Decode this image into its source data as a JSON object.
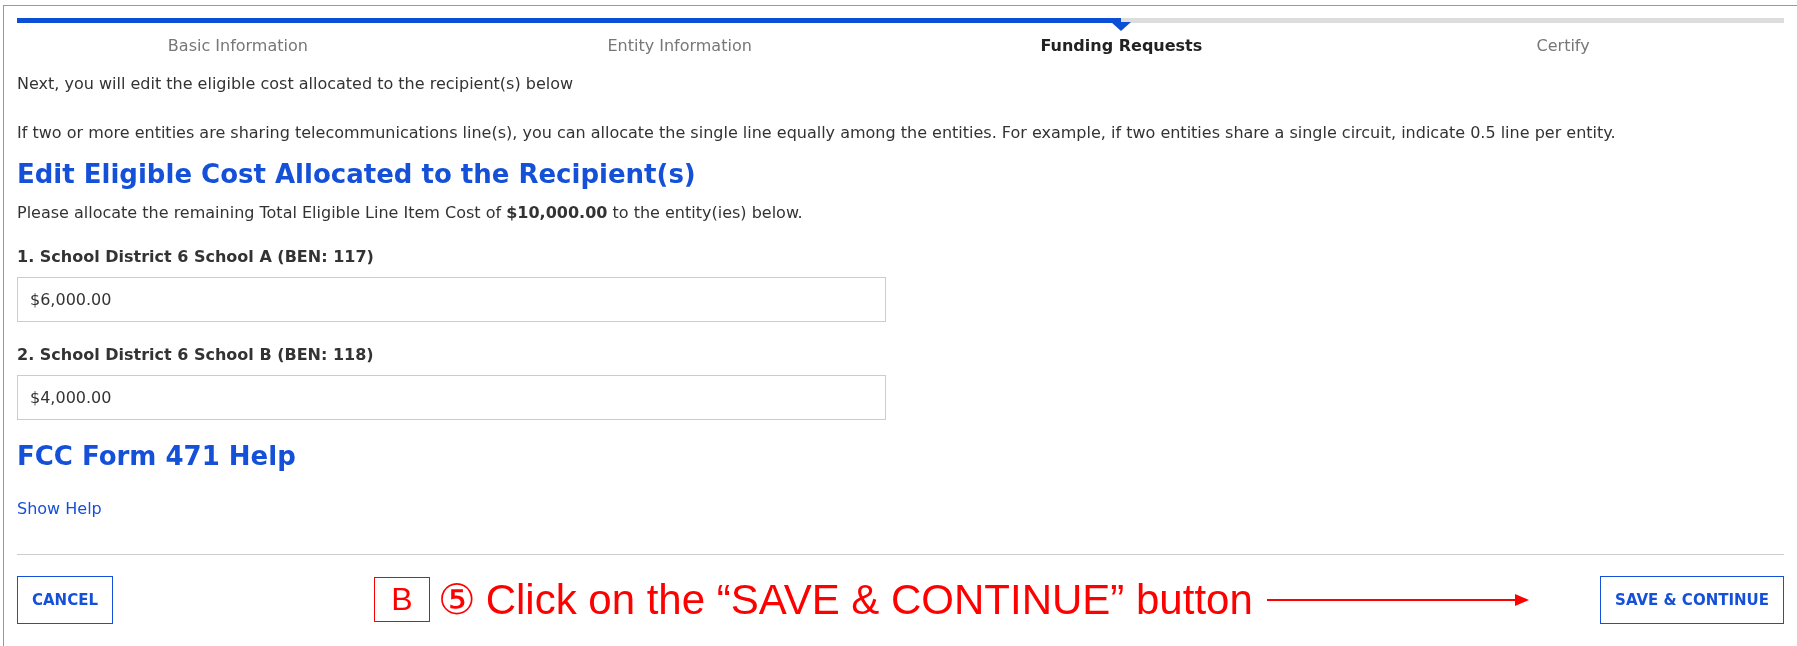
{
  "steps": [
    {
      "label": "Basic Information",
      "selected": false
    },
    {
      "label": "Entity Information",
      "selected": false
    },
    {
      "label": "Funding Requests",
      "selected": true
    },
    {
      "label": "Certify",
      "selected": false
    }
  ],
  "intro": [
    "Next, you will edit the eligible cost allocated to the recipient(s) below",
    "If two or more entities are sharing telecommunications line(s), you can allocate the single line equally among the entities. For example, if two entities share a single circuit, indicate 0.5 line per entity."
  ],
  "heading": "Edit Eligible Cost Allocated to the Recipient(s)",
  "instruction": "Please allocate the remaining Total Eligible Line Item Cost of **$10,000.00** to the entity(ies) below.",
  "entities": [
    {
      "label": "1. School District 6 School A (BEN: 117)",
      "value": "$6,000.00"
    },
    {
      "label": "2. School District 6 School B (BEN: 118)",
      "value": "$4,000.00"
    }
  ],
  "help": {
    "heading": "FCC Form 471 Help",
    "link": "Show Help"
  },
  "buttons": {
    "cancel": "CANCEL",
    "save": "SAVE & CONTINUE"
  },
  "annotation": {
    "tag": "B",
    "step": "⑤",
    "text": "Click on the “SAVE & CONTINUE” button"
  }
}
